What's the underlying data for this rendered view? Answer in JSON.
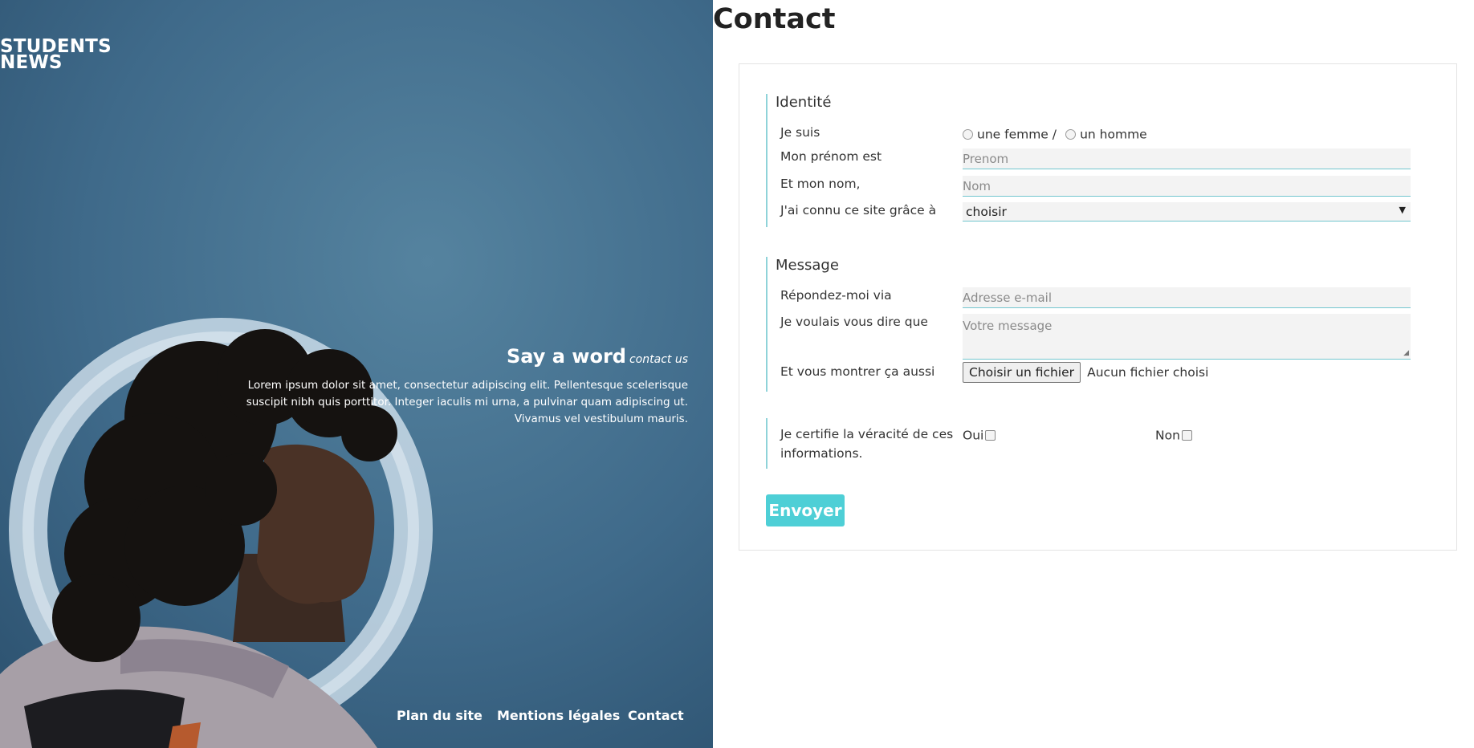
{
  "brand": {
    "line1": "STUDENTS",
    "line2": "NEWS"
  },
  "hero": {
    "title": "Say a word",
    "subtitle": "contact us",
    "text": "Lorem ipsum dolor sit amet, consectetur adipiscing elit. Pellentesque scelerisque suscipit nibh quis porttitor. Integer iaculis mi urna, a pulvinar quam adipiscing ut. Vivamus vel vestibulum mauris."
  },
  "footer": {
    "links": [
      "Plan du site",
      "Mentions légales",
      "Contact"
    ]
  },
  "page": {
    "title": "Contact"
  },
  "form": {
    "identity": {
      "legend": "Identité",
      "gender_label": "Je suis",
      "gender_female": "une femme /",
      "gender_male": "un homme",
      "firstname_label": "Mon prénom est",
      "firstname_placeholder": "Prenom",
      "lastname_label": "Et mon nom,",
      "lastname_placeholder": "Nom",
      "source_label": "J'ai connu ce site grâce à",
      "source_value": "choisir"
    },
    "message": {
      "legend": "Message",
      "email_label": "Répondez-moi via",
      "email_placeholder": "Adresse e-mail",
      "message_label": "Je voulais vous dire que",
      "message_placeholder": "Votre message",
      "file_label": "Et vous montrer ça aussi",
      "file_button": "Choisir un fichier",
      "file_status": "Aucun fichier choisi"
    },
    "certify": {
      "label_line1": "Je certifie la véracité de ces",
      "label_line2": "informations.",
      "yes": "Oui",
      "no": "Non"
    },
    "submit": "Envoyer"
  },
  "colors": {
    "accent": "#4ecfd6",
    "hero_blue": "#3f6a8a",
    "fieldset_rule": "#8fd3d9"
  }
}
